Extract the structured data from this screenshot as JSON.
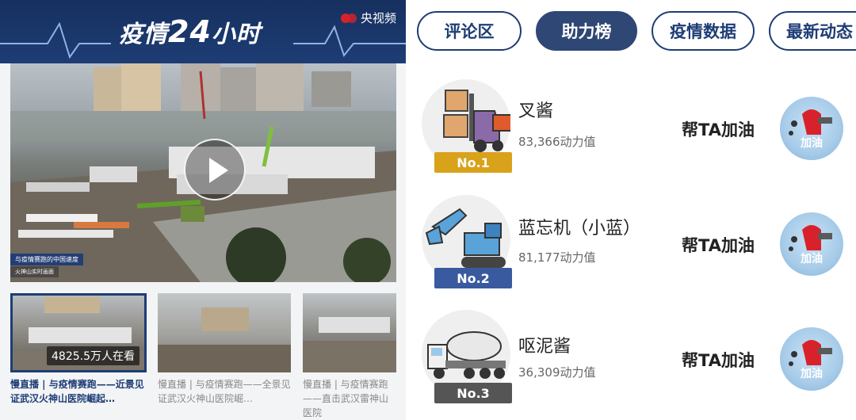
{
  "left_panel": {
    "banner": {
      "title_prefix": "疫情",
      "title_number": "24",
      "title_suffix": "小时",
      "brand": "央视频"
    },
    "main_video": {
      "caption_line1": "与疫情赛跑的中国速度",
      "caption_line2": "火神山实时画面"
    },
    "thumbnails": [
      {
        "title": "慢直播 | 与疫情赛跑——近景见证武汉火神山医院崛起…",
        "viewers": "4825.5万人在看",
        "active": true
      },
      {
        "title": "慢直播 | 与疫情赛跑——全景见证武汉火神山医院崛…",
        "viewers": "",
        "active": false
      },
      {
        "title": "慢直播 | 与疫情赛跑——直击武汉雷神山医院",
        "viewers": "",
        "active": false
      }
    ]
  },
  "right_panel": {
    "tabs": [
      {
        "label": "评论区",
        "active": false
      },
      {
        "label": "助力榜",
        "active": true
      },
      {
        "label": "疫情数据",
        "active": false
      },
      {
        "label": "最新动态",
        "active": false
      }
    ],
    "leaderboard": [
      {
        "rank": "No.1",
        "rank_color": "#d9a21b",
        "name": "叉酱",
        "power": "83,366动力值",
        "action": "帮TA加油",
        "fuel_label": "加油",
        "icon": "forklift-icon"
      },
      {
        "rank": "No.2",
        "rank_color": "#3a5aa0",
        "name": "蓝忘机（小蓝）",
        "power": "81,177动力值",
        "action": "帮TA加油",
        "fuel_label": "加油",
        "icon": "excavator-icon"
      },
      {
        "rank": "No.3",
        "rank_color": "#555555",
        "name": "呕泥酱",
        "power": "36,309动力值",
        "action": "帮TA加油",
        "fuel_label": "加油",
        "icon": "cement-mixer-icon"
      }
    ]
  },
  "colors": {
    "brand_blue": "#1e3d75",
    "tab_active": "#2f4774",
    "fuel_red": "#d8222b"
  }
}
